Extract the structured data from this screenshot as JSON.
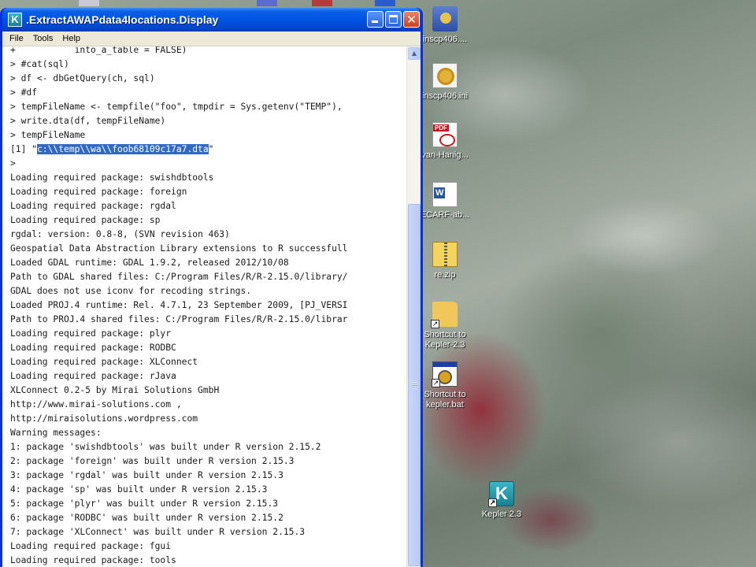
{
  "window": {
    "title": ".ExtractAWAPdata4locations.Display",
    "app_icon_letter": "K",
    "close_glyph": "✕"
  },
  "menu": [
    "File",
    "Tools",
    "Help"
  ],
  "console": {
    "lines": [
      "+           into_a_table = FALSE)",
      "> #cat(sql)",
      "> df <- dbGetQuery(ch, sql)",
      "> #df",
      "> tempFileName <- tempfile(\"foo\", tmpdir = Sys.getenv(\"TEMP\"),",
      "> write.dta(df, tempFileName)",
      "> tempFileName",
      "",
      ">",
      "Loading required package: swishdbtools",
      "Loading required package: foreign",
      "Loading required package: rgdal",
      "Loading required package: sp",
      "rgdal: version: 0.8-8, (SVN revision 463)",
      "Geospatial Data Abstraction Library extensions to R successfull",
      "Loaded GDAL runtime: GDAL 1.9.2, released 2012/10/08",
      "Path to GDAL shared files: C:/Program Files/R/R-2.15.0/library/",
      "GDAL does not use iconv for recoding strings.",
      "Loaded PROJ.4 runtime: Rel. 4.7.1, 23 September 2009, [PJ_VERSI",
      "Path to PROJ.4 shared files: C:/Program Files/R/R-2.15.0/librar",
      "Loading required package: plyr",
      "Loading required package: RODBC",
      "Loading required package: XLConnect",
      "Loading required package: rJava",
      "XLConnect 0.2-5 by Mirai Solutions GmbH",
      "http://www.mirai-solutions.com ,",
      "http://miraisolutions.wordpress.com",
      "Warning messages:",
      "1: package 'swishdbtools' was built under R version 2.15.2",
      "2: package 'foreign' was built under R version 2.15.3",
      "3: package 'rgdal' was built under R version 2.15.3",
      "4: package 'sp' was built under R version 2.15.3",
      "5: package 'plyr' was built under R version 2.15.3",
      "6: package 'RODBC' was built under R version 2.15.2",
      "7: package 'XLConnect' was built under R version 2.15.3",
      "Loading required package: fgui",
      "Loading required package: tools"
    ],
    "result_prefix": "[1] \"",
    "result_selected": "c:\\\\temp\\\\wa\\\\foob68109c17a7.dta",
    "result_suffix": "\""
  },
  "desktop_icons": [
    {
      "label": "inscp406....",
      "icon": "exe-icon",
      "shortcut": false
    },
    {
      "label": "inscp406.ini",
      "icon": "ini-file-icon",
      "shortcut": false
    },
    {
      "label": "van-Hanig...",
      "icon": "pdf-file-icon",
      "shortcut": false
    },
    {
      "label": "ECARF-ab...",
      "icon": "word-doc-icon",
      "shortcut": false
    },
    {
      "label": "re.zip",
      "icon": "zip-file-icon",
      "shortcut": false
    },
    {
      "label": "Shortcut to Kepler-2.3",
      "icon": "folder-icon",
      "shortcut": true
    },
    {
      "label": "Shortcut to kepler.bat",
      "icon": "batch-file-icon",
      "shortcut": true
    },
    {
      "label": "Kepler 2.3",
      "icon": "kepler-icon",
      "shortcut": true
    }
  ],
  "colors": {
    "titlebar": "#0054e3",
    "selection": "#316ac5",
    "close_button": "#c9401c"
  }
}
